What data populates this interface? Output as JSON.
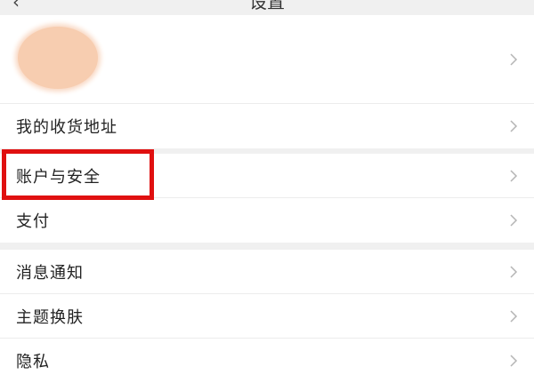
{
  "header": {
    "back_icon": "back-arrow-icon",
    "title": "设置"
  },
  "profile": {
    "avatar_color": "#f7cdb0",
    "chevron_icon": "chevron-right-icon"
  },
  "groups": [
    {
      "items": [
        {
          "label": "我的收货地址"
        }
      ]
    },
    {
      "items": [
        {
          "label": "账户与安全"
        },
        {
          "label": "支付"
        }
      ]
    },
    {
      "items": [
        {
          "label": "消息通知"
        },
        {
          "label": "主题换肤"
        },
        {
          "label": "隐私"
        }
      ]
    }
  ],
  "highlight": {
    "target": "账户与安全",
    "color": "#e01010"
  }
}
